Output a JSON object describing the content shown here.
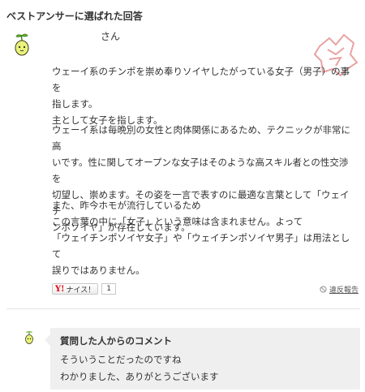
{
  "section": {
    "title": "ベストアンサーに選ばれた回答"
  },
  "answer": {
    "username": "さん",
    "paragraphs": [
      [
        "ウェーイ系のチンポを崇め奉りソイヤしたがっている女子（男子）の事を",
        "指します。",
        "主として女子を指します。"
      ],
      [
        "ウェーイ系は毎晩別の女性と肉体関係にあるため、テクニックが非常に高",
        "いです。性に関してオープンな女子はそのような高スキル者との性交渉を",
        "切望し、崇めます。その姿を一言で表すのに最適な言葉として「ウェイチ",
        "ンポソイヤ」が存在しています。"
      ],
      [
        "また、昨今ホモが流行しているため",
        "この言葉の中に「女子」という意味は含まれません。よって",
        "「ウェイチンポソイヤ女子」や「ウェイチンポソイヤ男子」は用法として",
        "誤りではありません。"
      ]
    ],
    "nice_label": "ナイス！",
    "nice_logo": "Y!",
    "nice_count": "1",
    "report_label": "違反報告"
  },
  "comment": {
    "title": "質問した人からのコメント",
    "lines": [
      "そういうことだったのですね",
      "わかりました、ありがとうございます"
    ]
  },
  "icons": {
    "avatar": "sprout-character-icon",
    "stamp": "best-answer-stamp-icon",
    "report": "prohibited-icon"
  },
  "colors": {
    "comment_bg": "#efefef",
    "yahoo_red": "#e60012",
    "stamp_red": "#e9a2a2"
  }
}
